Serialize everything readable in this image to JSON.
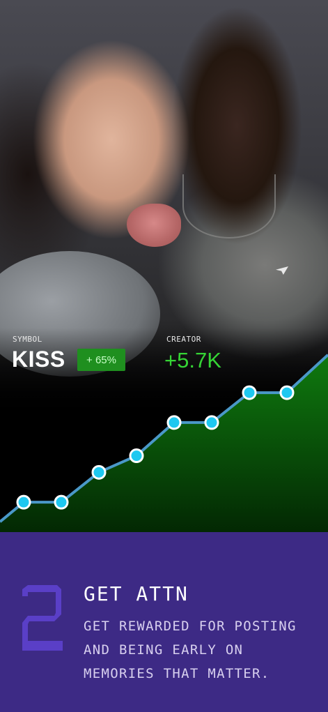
{
  "stats": {
    "symbol_label": "SYMBOL",
    "symbol": "KISS",
    "change": "+ 65%",
    "creator_label": "CREATOR",
    "creator_value": "+5.7K"
  },
  "chart_data": {
    "type": "area",
    "points": [
      18,
      18,
      36,
      46,
      66,
      66,
      84,
      84
    ]
  },
  "step": {
    "number": "2",
    "title": "GET ATTN",
    "description": "GET REWARDED FOR POSTING AND BEING EARLY ON MEMORIES THAT MATTER."
  },
  "colors": {
    "background": "#3d2a85",
    "accent_green": "#35d435",
    "badge_green": "#1f8f1f",
    "line_blue": "#4a98c8",
    "point_cyan": "#1ec8f0",
    "step_number": "#5a3fc7"
  }
}
